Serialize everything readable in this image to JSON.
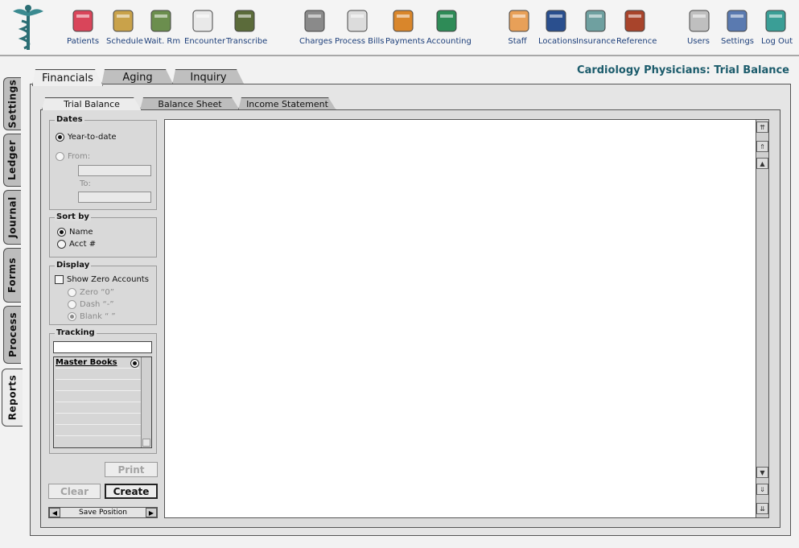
{
  "toolbar": {
    "groups": [
      [
        {
          "label": "Patients",
          "icon": "patients-icon"
        },
        {
          "label": "Schedule",
          "icon": "schedule-icon"
        },
        {
          "label": "Wait. Rm",
          "icon": "waiting-room-icon"
        },
        {
          "label": "Encounter",
          "icon": "encounter-icon"
        },
        {
          "label": "Transcribe",
          "icon": "transcribe-icon"
        }
      ],
      [
        {
          "label": "Charges",
          "icon": "charges-icon"
        },
        {
          "label": "Process Bills",
          "icon": "process-bills-icon"
        },
        {
          "label": "Payments",
          "icon": "payments-icon"
        },
        {
          "label": "Accounting",
          "icon": "accounting-icon"
        }
      ],
      [
        {
          "label": "Staff",
          "icon": "staff-icon"
        },
        {
          "label": "Locations",
          "icon": "locations-icon"
        },
        {
          "label": "Insurance",
          "icon": "insurance-icon"
        },
        {
          "label": "Reference",
          "icon": "reference-icon"
        }
      ],
      [
        {
          "label": "Users",
          "icon": "users-icon"
        },
        {
          "label": "Settings",
          "icon": "settings-icon"
        },
        {
          "label": "Log Out",
          "icon": "log-out-icon"
        }
      ]
    ]
  },
  "side_tabs": [
    "Settings",
    "Ledger",
    "Journal",
    "Forms",
    "Process",
    "Reports"
  ],
  "main_tabs": [
    "Financials",
    "Aging",
    "Inquiry"
  ],
  "page_title": "Cardiology Physicians: Trial Balance",
  "sub_tabs": [
    "Trial Balance",
    "Balance Sheet",
    "Income Statement"
  ],
  "dates": {
    "title": "Dates",
    "ytd": "Year-to-date",
    "from": "From:",
    "to": "To:"
  },
  "sort": {
    "title": "Sort by",
    "name": "Name",
    "acct": "Acct #"
  },
  "display": {
    "title": "Display",
    "show_zero": "Show Zero Accounts",
    "zero": "Zero “0”",
    "dash": "Dash “-”",
    "blank": "Blank “ ”"
  },
  "tracking": {
    "title": "Tracking",
    "search_value": "",
    "list_header": "Master Books"
  },
  "buttons": {
    "print": "Print",
    "clear": "Clear",
    "create": "Create",
    "save_position": "Save Position"
  },
  "colors": {
    "title": "#1b5b6b",
    "toolbar_label": "#1d3f7a"
  }
}
